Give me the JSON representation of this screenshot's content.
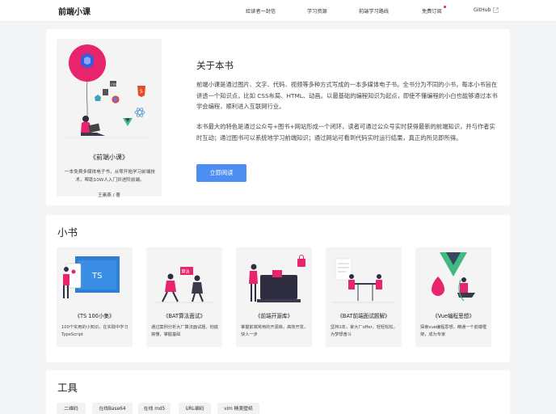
{
  "header": {
    "logo": "前端小课",
    "links": [
      {
        "label": "给读者一封信"
      },
      {
        "label": "学习资源"
      },
      {
        "label": "前端学习路线"
      },
      {
        "label": "免费订阅"
      },
      {
        "label": "GitHub"
      }
    ],
    "subscribe_dot_color": "#e02b2b"
  },
  "hero": {
    "book": {
      "title": "《前端小课》",
      "description": "一本免费多媒体电子书，从零开始学习前端技术，帮助10W人入门并进阶前端。",
      "author": "王素燕 / 著",
      "badges": [
        "CSS",
        "5"
      ]
    },
    "about_title": "关于本书",
    "paragraphs": [
      "前端小课是通过图片、文字、代码、视频等多种方式写成的一本多媒体电子书。全书分为不同的小书，每本小书旨在讲透一个知识点，比如 CSS布局、HTML、动画。以最基础的编程知识为起点，即使不懂编程的小白也能够通过本书学会编程，顺利进入互联网行业。",
      "本书最大的特色是通过公众号+图书+网站形成一个闭环，读者可通过公众号实时获得最新的前端知识，并与作者实时互动；通过图书可以系统地学习前端知识；通过网站可看到代码实时运行结果，真正的所见即所得。"
    ],
    "cta": "立即阅读",
    "accent": "#4d8ef2"
  },
  "books_section": {
    "title": "小书",
    "books": [
      {
        "name": "《TS 100小集》",
        "desc": "100个实用的小知识，在实践中学习 TypeScript",
        "badge": "TS"
      },
      {
        "name": "《BAT算法面试》",
        "desc": "通过案例分析大厂算法面试题，彻底搞懂，掌握基础",
        "badge": "算法"
      },
      {
        "name": "《前端开源库》",
        "desc": "掌握前端常用的开源库，高效开发，快人一步",
        "badge": ""
      },
      {
        "name": "《BAT前端面试题解》",
        "desc": "坚持1年，拿大厂offer，轻轻松松，为梦想奋斗",
        "badge": ""
      },
      {
        "name": "《Vue编程思想》",
        "desc": "探索vue编程思想，精通一个前端框架，成为专家",
        "badge": ""
      }
    ]
  },
  "tools_section": {
    "title": "工具",
    "tools": [
      {
        "label": "二维码"
      },
      {
        "label": "在线Base64"
      },
      {
        "label": "在线 md5"
      },
      {
        "label": "URL编码"
      },
      {
        "label": "vim 精美壁纸"
      }
    ]
  }
}
